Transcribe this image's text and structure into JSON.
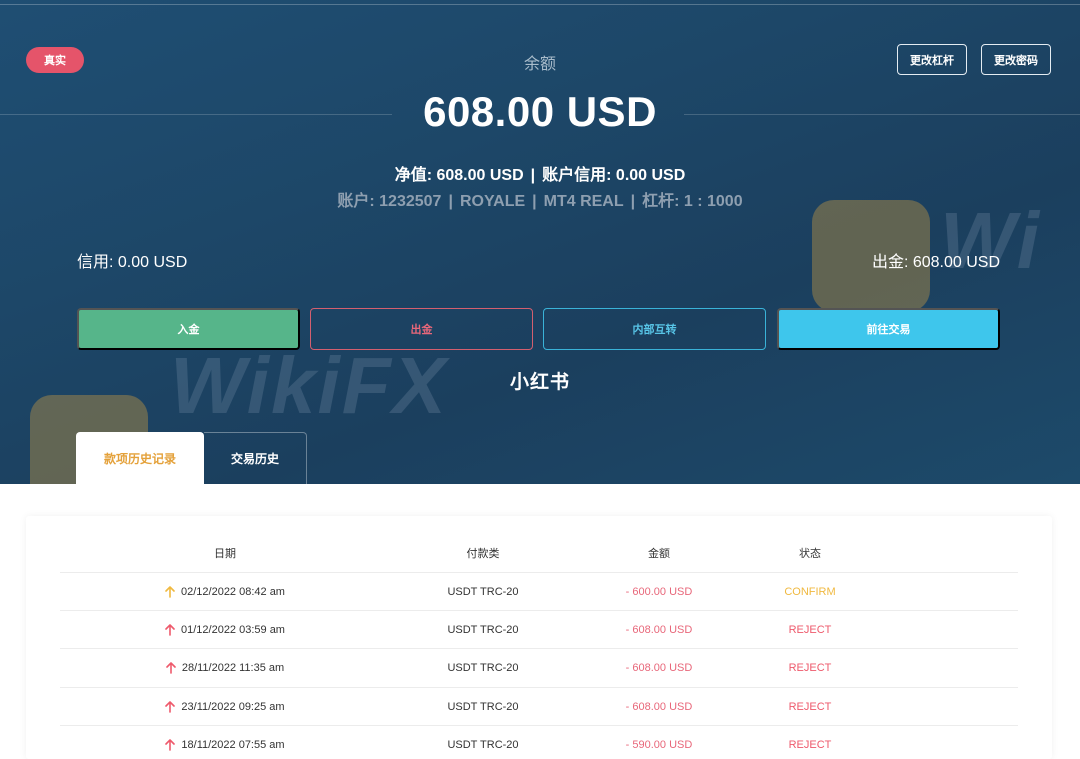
{
  "header": {
    "account_type_badge": "真实",
    "balance_label": "余额",
    "balance_amount": "608.00 USD",
    "change_leverage_button": "更改杠杆",
    "change_password_button": "更改密码",
    "equity_text": "净值: 608.00 USD",
    "account_credit_text": "账户信用: 0.00 USD",
    "account_number_text": "账户: 1232507",
    "server_text": "ROYALE",
    "platform_text": "MT4 REAL",
    "leverage_text": "杠杆: 1 : 1000",
    "separator": "|",
    "credit_text": "信用: 0.00 USD",
    "withdrawable_text": "出金: 608.00 USD"
  },
  "actions": {
    "deposit": "入金",
    "withdraw": "出金",
    "internal_transfer": "内部互转",
    "go_trade": "前往交易"
  },
  "watermark": {
    "xiaohongshu": "小红书",
    "wikifx": "WikiFX"
  },
  "tabs": {
    "funds_history": "款项历史记录",
    "trade_history": "交易历史"
  },
  "table": {
    "columns": [
      "日期",
      "付款类",
      "金额",
      "状态"
    ],
    "rows": [
      {
        "date": "02/12/2022 08:42 am",
        "method": "USDT TRC-20",
        "amount": "- 600.00 USD",
        "status": "CONFIRM"
      },
      {
        "date": "01/12/2022 03:59 am",
        "method": "USDT TRC-20",
        "amount": "- 608.00 USD",
        "status": "REJECT"
      },
      {
        "date": "28/11/2022 11:35 am",
        "method": "USDT TRC-20",
        "amount": "- 608.00 USD",
        "status": "REJECT"
      },
      {
        "date": "23/11/2022 09:25 am",
        "method": "USDT TRC-20",
        "amount": "- 608.00 USD",
        "status": "REJECT"
      },
      {
        "date": "18/11/2022 07:55 am",
        "method": "USDT TRC-20",
        "amount": "- 590.00 USD",
        "status": "REJECT"
      }
    ]
  },
  "colors": {
    "confirm": "#f0b940",
    "reject": "#ee5a6c",
    "deposit_button": "#56b58a",
    "trade_button": "#3ec6ec"
  },
  "icons": {
    "row_arrow": "arrow-up-icon"
  }
}
